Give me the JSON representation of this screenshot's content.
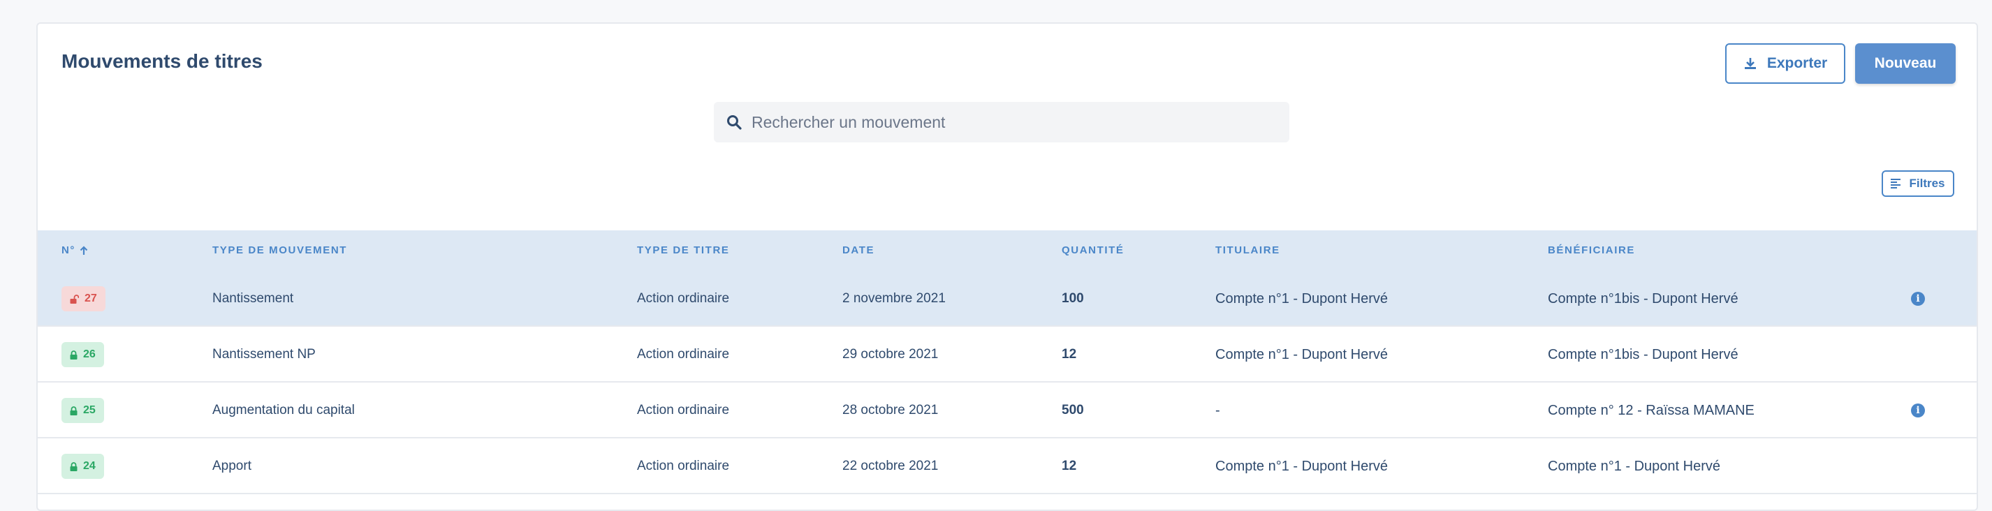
{
  "page": {
    "title": "Mouvements de titres"
  },
  "toolbar": {
    "export_label": "Exporter",
    "new_label": "Nouveau",
    "filters_label": "Filtres"
  },
  "search": {
    "placeholder": "Rechercher un mouvement",
    "value": ""
  },
  "table": {
    "columns": [
      "N°",
      "TYPE DE MOUVEMENT",
      "TYPE DE TITRE",
      "DATE",
      "QUANTITÉ",
      "TITULAIRE",
      "BÉNÉFICIAIRE"
    ],
    "sort_column": "N°",
    "sort_direction": "ascending",
    "rows": [
      {
        "num": "27",
        "status": "unlocked",
        "status_color": "#d9534f",
        "type": "Nantissement",
        "title_type": "Action ordinaire",
        "date": "2 novembre 2021",
        "qty": "100",
        "holder": "Compte n°1 - Dupont Hervé",
        "beneficiary": "Compte n°1bis - Dupont Hervé",
        "info": true,
        "selected": true
      },
      {
        "num": "26",
        "status": "locked",
        "status_color": "#2aa764",
        "type": "Nantissement NP",
        "title_type": "Action ordinaire",
        "date": "29 octobre 2021",
        "qty": "12",
        "holder": "Compte n°1 - Dupont Hervé",
        "beneficiary": "Compte n°1bis - Dupont Hervé",
        "info": false,
        "selected": false
      },
      {
        "num": "25",
        "status": "locked",
        "status_color": "#2aa764",
        "type": "Augmentation du capital",
        "title_type": "Action ordinaire",
        "date": "28 octobre 2021",
        "qty": "500",
        "holder": "-",
        "beneficiary": "Compte n° 12 - Raïssa MAMANE",
        "info": true,
        "selected": false
      },
      {
        "num": "24",
        "status": "locked",
        "status_color": "#2aa764",
        "type": "Apport",
        "title_type": "Action ordinaire",
        "date": "22 octobre 2021",
        "qty": "12",
        "holder": "Compte n°1 - Dupont Hervé",
        "beneficiary": "Compte n°1 - Dupont Hervé",
        "info": false,
        "selected": false
      }
    ]
  },
  "icons": {
    "export": "download-icon",
    "search": "search-icon",
    "filters": "filter-lines-icon",
    "sort": "arrow-up-icon",
    "locked": "lock-icon",
    "unlocked": "unlock-icon",
    "info": "info-icon"
  },
  "colors": {
    "accent": "#4a86c8",
    "primary_button": "#5b8fcf",
    "header_bg": "#dde8f4",
    "danger": "#d9534f",
    "success": "#2aa764"
  }
}
